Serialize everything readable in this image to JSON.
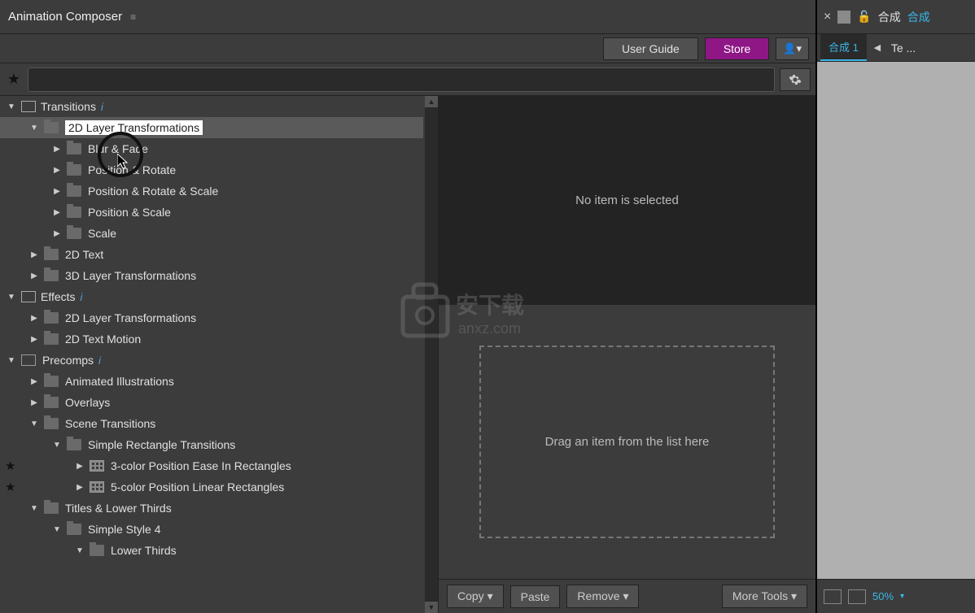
{
  "header": {
    "title": "Animation Composer"
  },
  "toolbar": {
    "user_guide": "User Guide",
    "store": "Store"
  },
  "search": {
    "placeholder": ""
  },
  "tree": [
    {
      "indent": 0,
      "arrow": "down",
      "icon": "cat",
      "label": "Transitions",
      "info": true
    },
    {
      "indent": 1,
      "arrow": "down",
      "icon": "folder",
      "label": "2D Layer Transformations",
      "selected": true
    },
    {
      "indent": 2,
      "arrow": "right",
      "icon": "folder",
      "label": "Blur & Fade"
    },
    {
      "indent": 2,
      "arrow": "right",
      "icon": "folder",
      "label": "Position & Rotate"
    },
    {
      "indent": 2,
      "arrow": "right",
      "icon": "folder",
      "label": "Position & Rotate & Scale"
    },
    {
      "indent": 2,
      "arrow": "right",
      "icon": "folder",
      "label": "Position & Scale"
    },
    {
      "indent": 2,
      "arrow": "right",
      "icon": "folder",
      "label": "Scale"
    },
    {
      "indent": 1,
      "arrow": "right",
      "icon": "folder",
      "label": "2D Text"
    },
    {
      "indent": 1,
      "arrow": "right",
      "icon": "folder",
      "label": "3D Layer Transformations"
    },
    {
      "indent": 0,
      "arrow": "down",
      "icon": "cat",
      "label": "Effects",
      "info": true
    },
    {
      "indent": 1,
      "arrow": "right",
      "icon": "folder",
      "label": "2D Layer Transformations"
    },
    {
      "indent": 1,
      "arrow": "right",
      "icon": "folder",
      "label": "2D Text Motion"
    },
    {
      "indent": 0,
      "arrow": "down",
      "icon": "precomp-cat",
      "label": "Precomps",
      "info": true
    },
    {
      "indent": 1,
      "arrow": "right",
      "icon": "folder",
      "label": "Animated Illustrations"
    },
    {
      "indent": 1,
      "arrow": "right",
      "icon": "folder",
      "label": "Overlays"
    },
    {
      "indent": 1,
      "arrow": "down",
      "icon": "folder",
      "label": "Scene Transitions"
    },
    {
      "indent": 2,
      "arrow": "down",
      "icon": "folder",
      "label": "Simple Rectangle Transitions"
    },
    {
      "indent": 3,
      "arrow": "right",
      "icon": "precomp",
      "label": "3-color Position Ease In Rectangles",
      "star": true
    },
    {
      "indent": 3,
      "arrow": "right",
      "icon": "precomp",
      "label": "5-color Position Linear Rectangles",
      "star": true
    },
    {
      "indent": 1,
      "arrow": "down",
      "icon": "folder",
      "label": "Titles & Lower Thirds"
    },
    {
      "indent": 2,
      "arrow": "down",
      "icon": "folder",
      "label": "Simple Style 4"
    },
    {
      "indent": 3,
      "arrow": "down",
      "icon": "folder",
      "label": "Lower Thirds"
    }
  ],
  "preview": {
    "empty_msg": "No item is selected",
    "drop_msg": "Drag an item from the list here"
  },
  "bottom": {
    "copy": "Copy",
    "paste": "Paste",
    "remove": "Remove",
    "more_tools": "More Tools"
  },
  "right": {
    "comp_label": "合成",
    "comp_link": "合成",
    "tab_active": "合成 1",
    "tab_other": "Te ...",
    "zoom": "50%"
  }
}
